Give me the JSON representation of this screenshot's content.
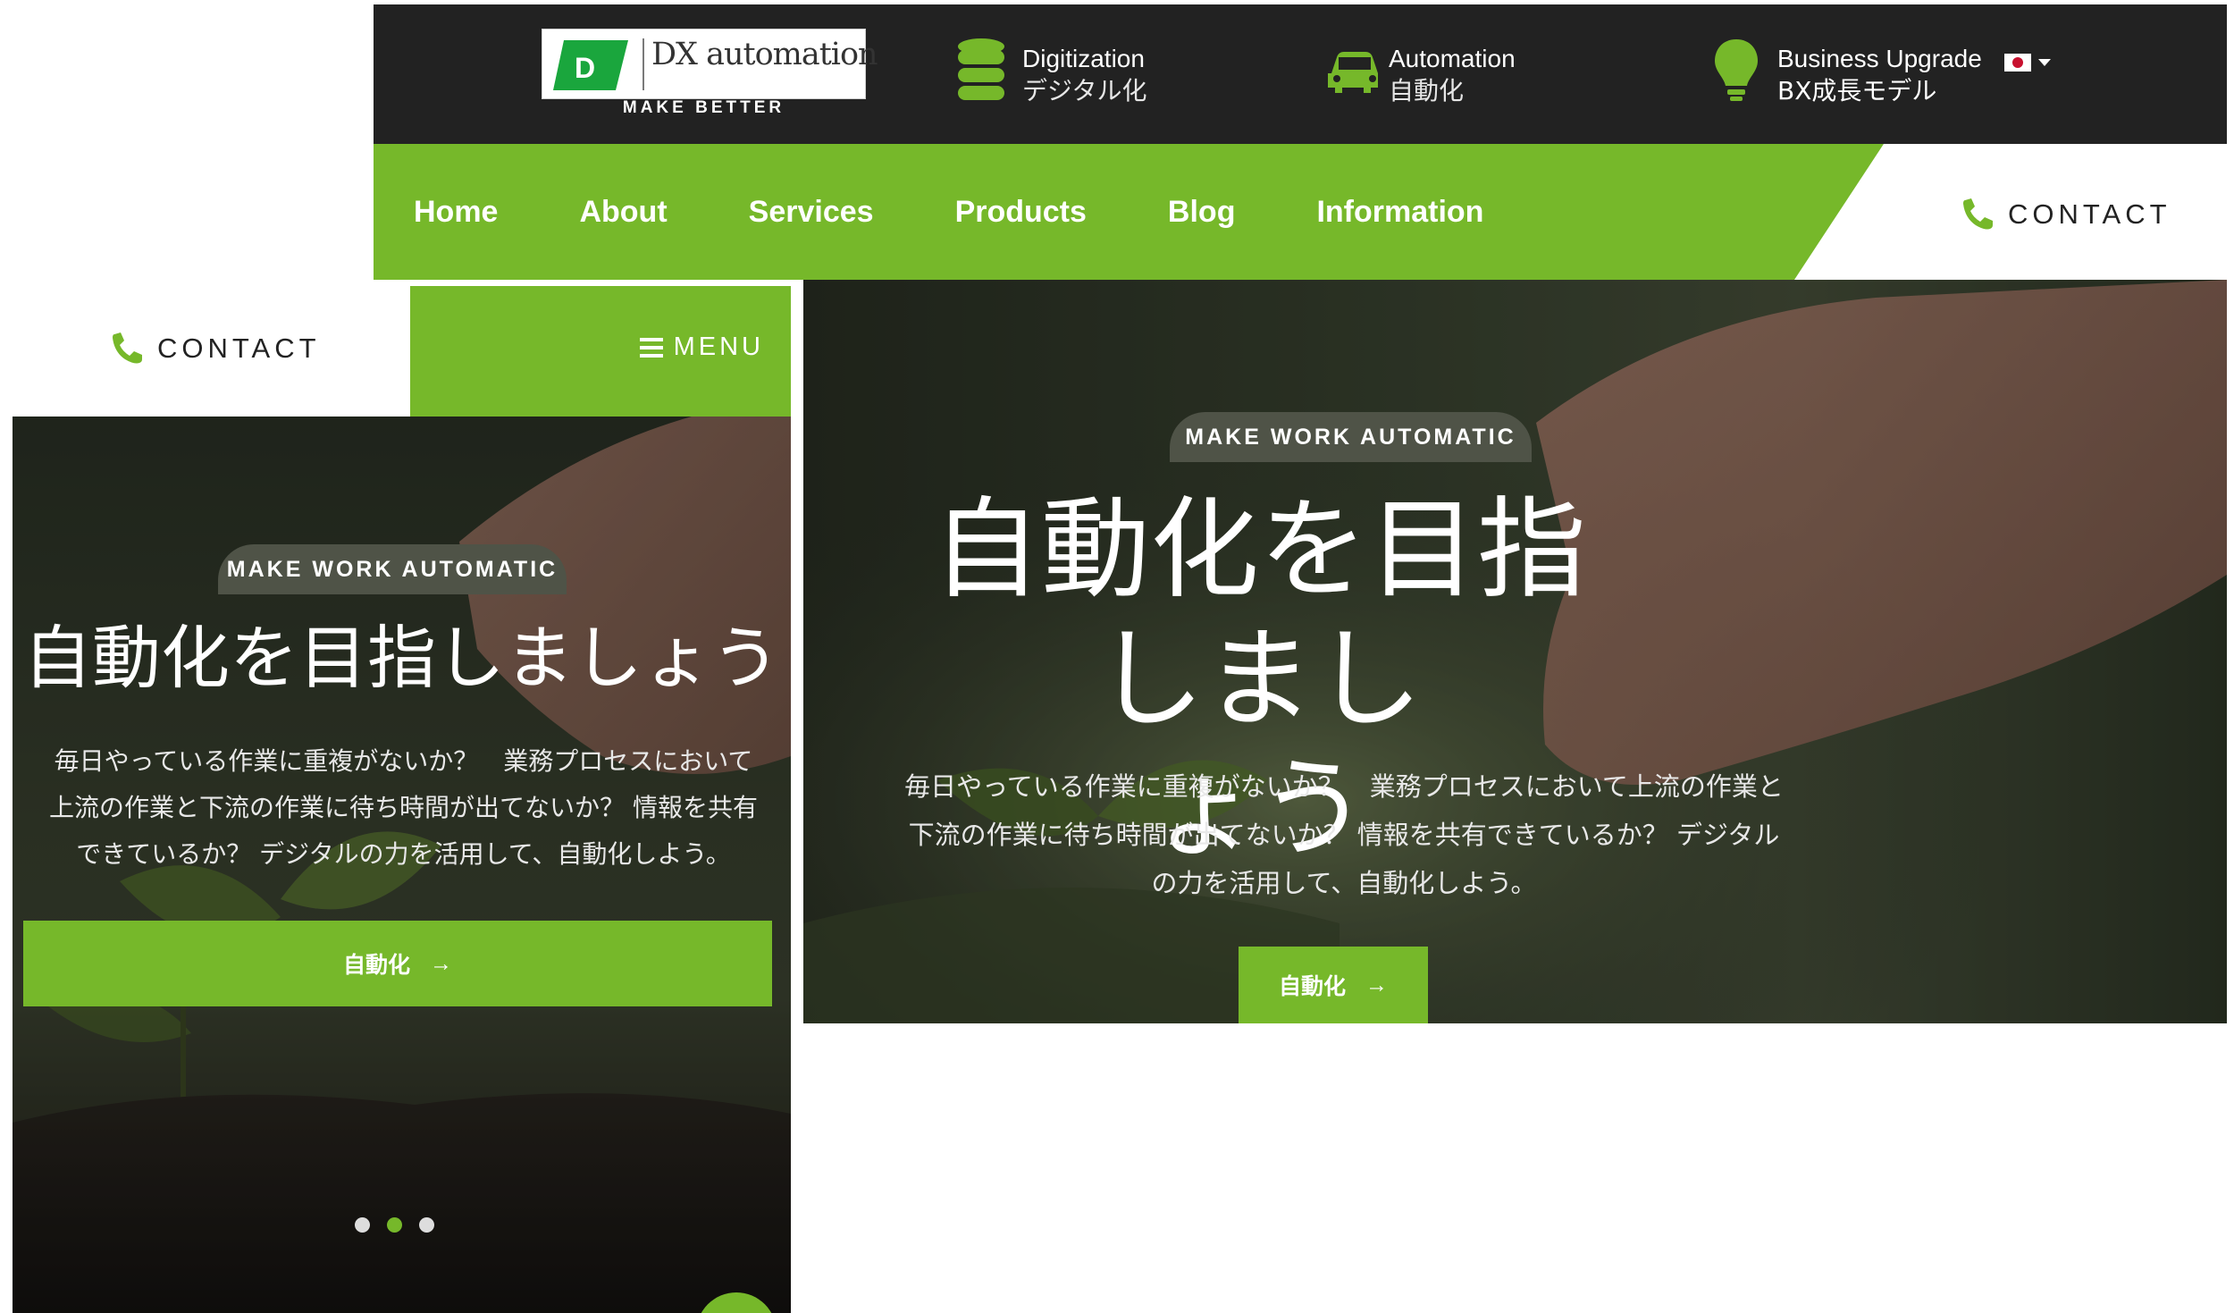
{
  "brand": {
    "logo_letter": "D",
    "name": "DX automation",
    "tagline": "MAKE BETTER"
  },
  "info_bar": [
    {
      "icon": "database-icon",
      "title": "Digitization",
      "subtitle": "デジタル化"
    },
    {
      "icon": "car-icon",
      "title": "Automation",
      "subtitle": "自動化"
    },
    {
      "icon": "lightbulb-icon",
      "title": "Business Upgrade",
      "subtitle": "BX成長モデル"
    }
  ],
  "language": {
    "flag": "jp-flag-icon"
  },
  "nav": {
    "items": [
      "Home",
      "About",
      "Services",
      "Products",
      "Blog",
      "Information"
    ],
    "contact_label": "CONTACT"
  },
  "hero": {
    "badge": "MAKE WORK AUTOMATIC",
    "title_desktop_line1": "自動化を目指しまし",
    "title_desktop_line2": "ょう",
    "title_mobile": "自動化を目指しましょう",
    "desc_desktop_lines": [
      "毎日やっている作業に重複がないか？　業務プロセスにおいて上流の作業と",
      "下流の作業に待ち時間が出てないか？ 情報を共有できているか？ デジタル",
      "の力を活用して、自動化しよう。"
    ],
    "desc_mobile_lines": [
      "毎日やっている作業に重複がないか？　業務プロセスにおいて",
      "上流の作業と下流の作業に待ち時間が出てないか？ 情報を共有",
      "できているか？ デジタルの力を活用して、自動化しよう。"
    ],
    "button_label": "自動化",
    "button_arrow": "→"
  },
  "mobile": {
    "contact_label": "CONTACT",
    "menu_label": "MENU",
    "slide_active": 2,
    "slide_count": 3
  },
  "colors": {
    "accent": "#76b82a",
    "topbar": "#222222",
    "badge": "#4f5347"
  }
}
